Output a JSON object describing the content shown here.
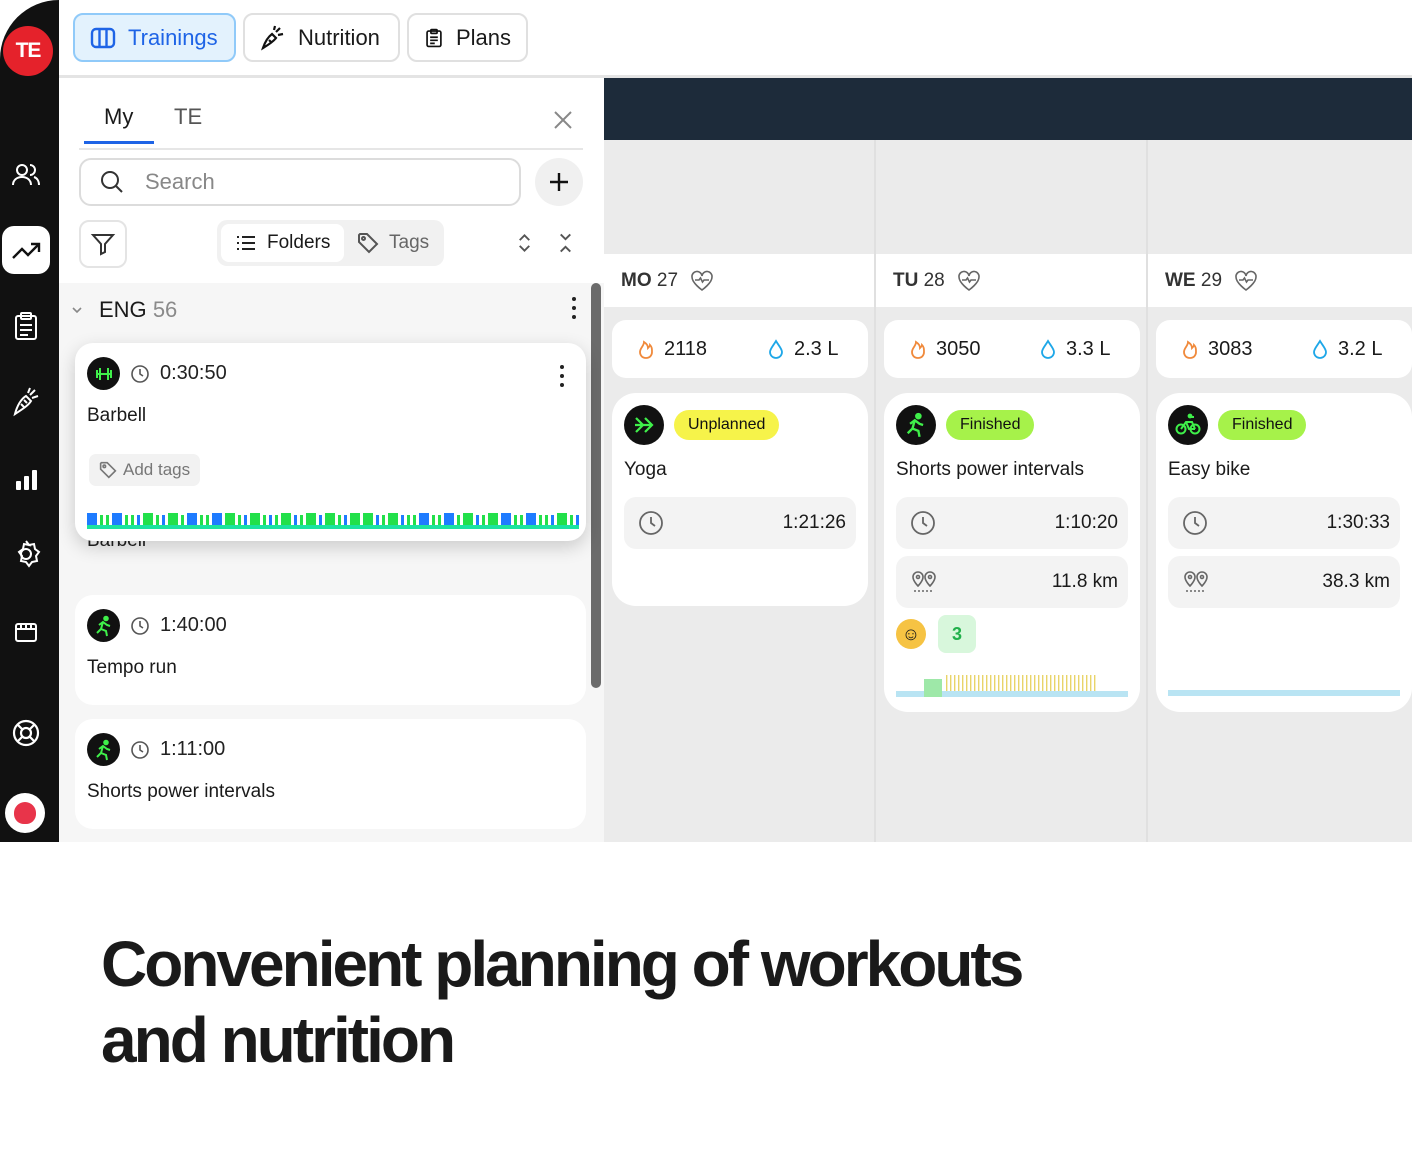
{
  "rail": {
    "logo_text": "TE",
    "icons": [
      "users-icon",
      "trending-icon",
      "clipboard-icon",
      "carrot-icon",
      "stats-icon",
      "settings-icon",
      "calendar-icon",
      "help-icon",
      "avatar-icon"
    ]
  },
  "topbar": {
    "tabs": [
      {
        "label": "Trainings",
        "icon": "columns-icon",
        "active": true
      },
      {
        "label": "Nutrition",
        "icon": "carrot-icon",
        "active": false
      },
      {
        "label": "Plans",
        "icon": "clipboard-icon",
        "active": false
      }
    ]
  },
  "library": {
    "tabs": [
      "My",
      "TE"
    ],
    "search_placeholder": "Search",
    "segments": {
      "folders": "Folders",
      "tags": "Tags"
    },
    "group": {
      "name": "ENG",
      "count": "56"
    },
    "cards": [
      {
        "sport": "barbell",
        "duration": "0:30:50",
        "title": "Barbell",
        "add_tags": "Add tags"
      },
      {
        "sport": "running",
        "duration": "1:40:00",
        "title": "Tempo run"
      },
      {
        "sport": "running",
        "duration": "1:11:00",
        "title": "Shorts power intervals"
      }
    ],
    "ghost_title": "Barbell"
  },
  "calendar": {
    "days": [
      {
        "label": "MO",
        "num": "27",
        "calories": "2118",
        "water": "2.3 L",
        "workout": {
          "sport": "arrow",
          "status": "Unplanned",
          "title": "Yoga",
          "duration": "1:21:26"
        }
      },
      {
        "label": "TU",
        "num": "28",
        "calories": "3050",
        "water": "3.3 L",
        "workout": {
          "sport": "running",
          "status": "Finished",
          "title": "Shorts power intervals",
          "duration": "1:10:20",
          "distance": "11.8 km",
          "rpe": "3"
        }
      },
      {
        "label": "WE",
        "num": "29",
        "calories": "3083",
        "water": "3.2 L",
        "workout": {
          "sport": "bike",
          "status": "Finished",
          "title": "Easy bike",
          "duration": "1:30:33",
          "distance": "38.3 km"
        }
      }
    ]
  },
  "headline": {
    "line1": "Convenient planning of workouts",
    "line2": "and nutrition"
  },
  "colors": {
    "brand_red": "#e5222b",
    "accent_blue": "#1e64e6",
    "green_badge": "#a6f24a",
    "yellow_badge": "#f6f34a",
    "calendar_header": "#1d2b3a"
  }
}
